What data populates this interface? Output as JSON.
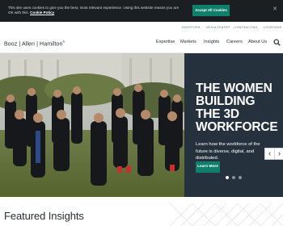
{
  "cookie_banner": {
    "text": "This site uses cookies to give you the best, most relevant experience. Using this website means you are OK with this.",
    "policy_link": "Cookie Policy",
    "accept_label": "Accept All Cookies",
    "close_icon": "close-icon"
  },
  "utility_nav": {
    "items": [
      "INVESTORS",
      "MEDIA CENTER",
      "CONTRACTING",
      "LOCATIONS"
    ]
  },
  "header": {
    "logo": "Booz | Allen | Hamilton",
    "logo_mark": "®",
    "nav": [
      "Expertise",
      "Markets",
      "Insights",
      "Careers",
      "About Us"
    ],
    "search_icon": "search-icon"
  },
  "hero": {
    "title": "THE WOMEN\nBUILDING\nTHE 3D\nWORKFORCE",
    "text": "Learn how the workforce of the future is diverse, digital, and distributed.",
    "button": "Learn More",
    "prev_icon": "chevron-left-icon",
    "next_icon": "chevron-right-icon",
    "slide_count": 3,
    "active_slide": 1
  },
  "featured": {
    "title": "Featured Insights"
  },
  "colors": {
    "accent": "#0f7f6c",
    "banner_bg": "#1b1f22",
    "panel_bg": "#25313d",
    "text_dark": "#2a2e31"
  }
}
